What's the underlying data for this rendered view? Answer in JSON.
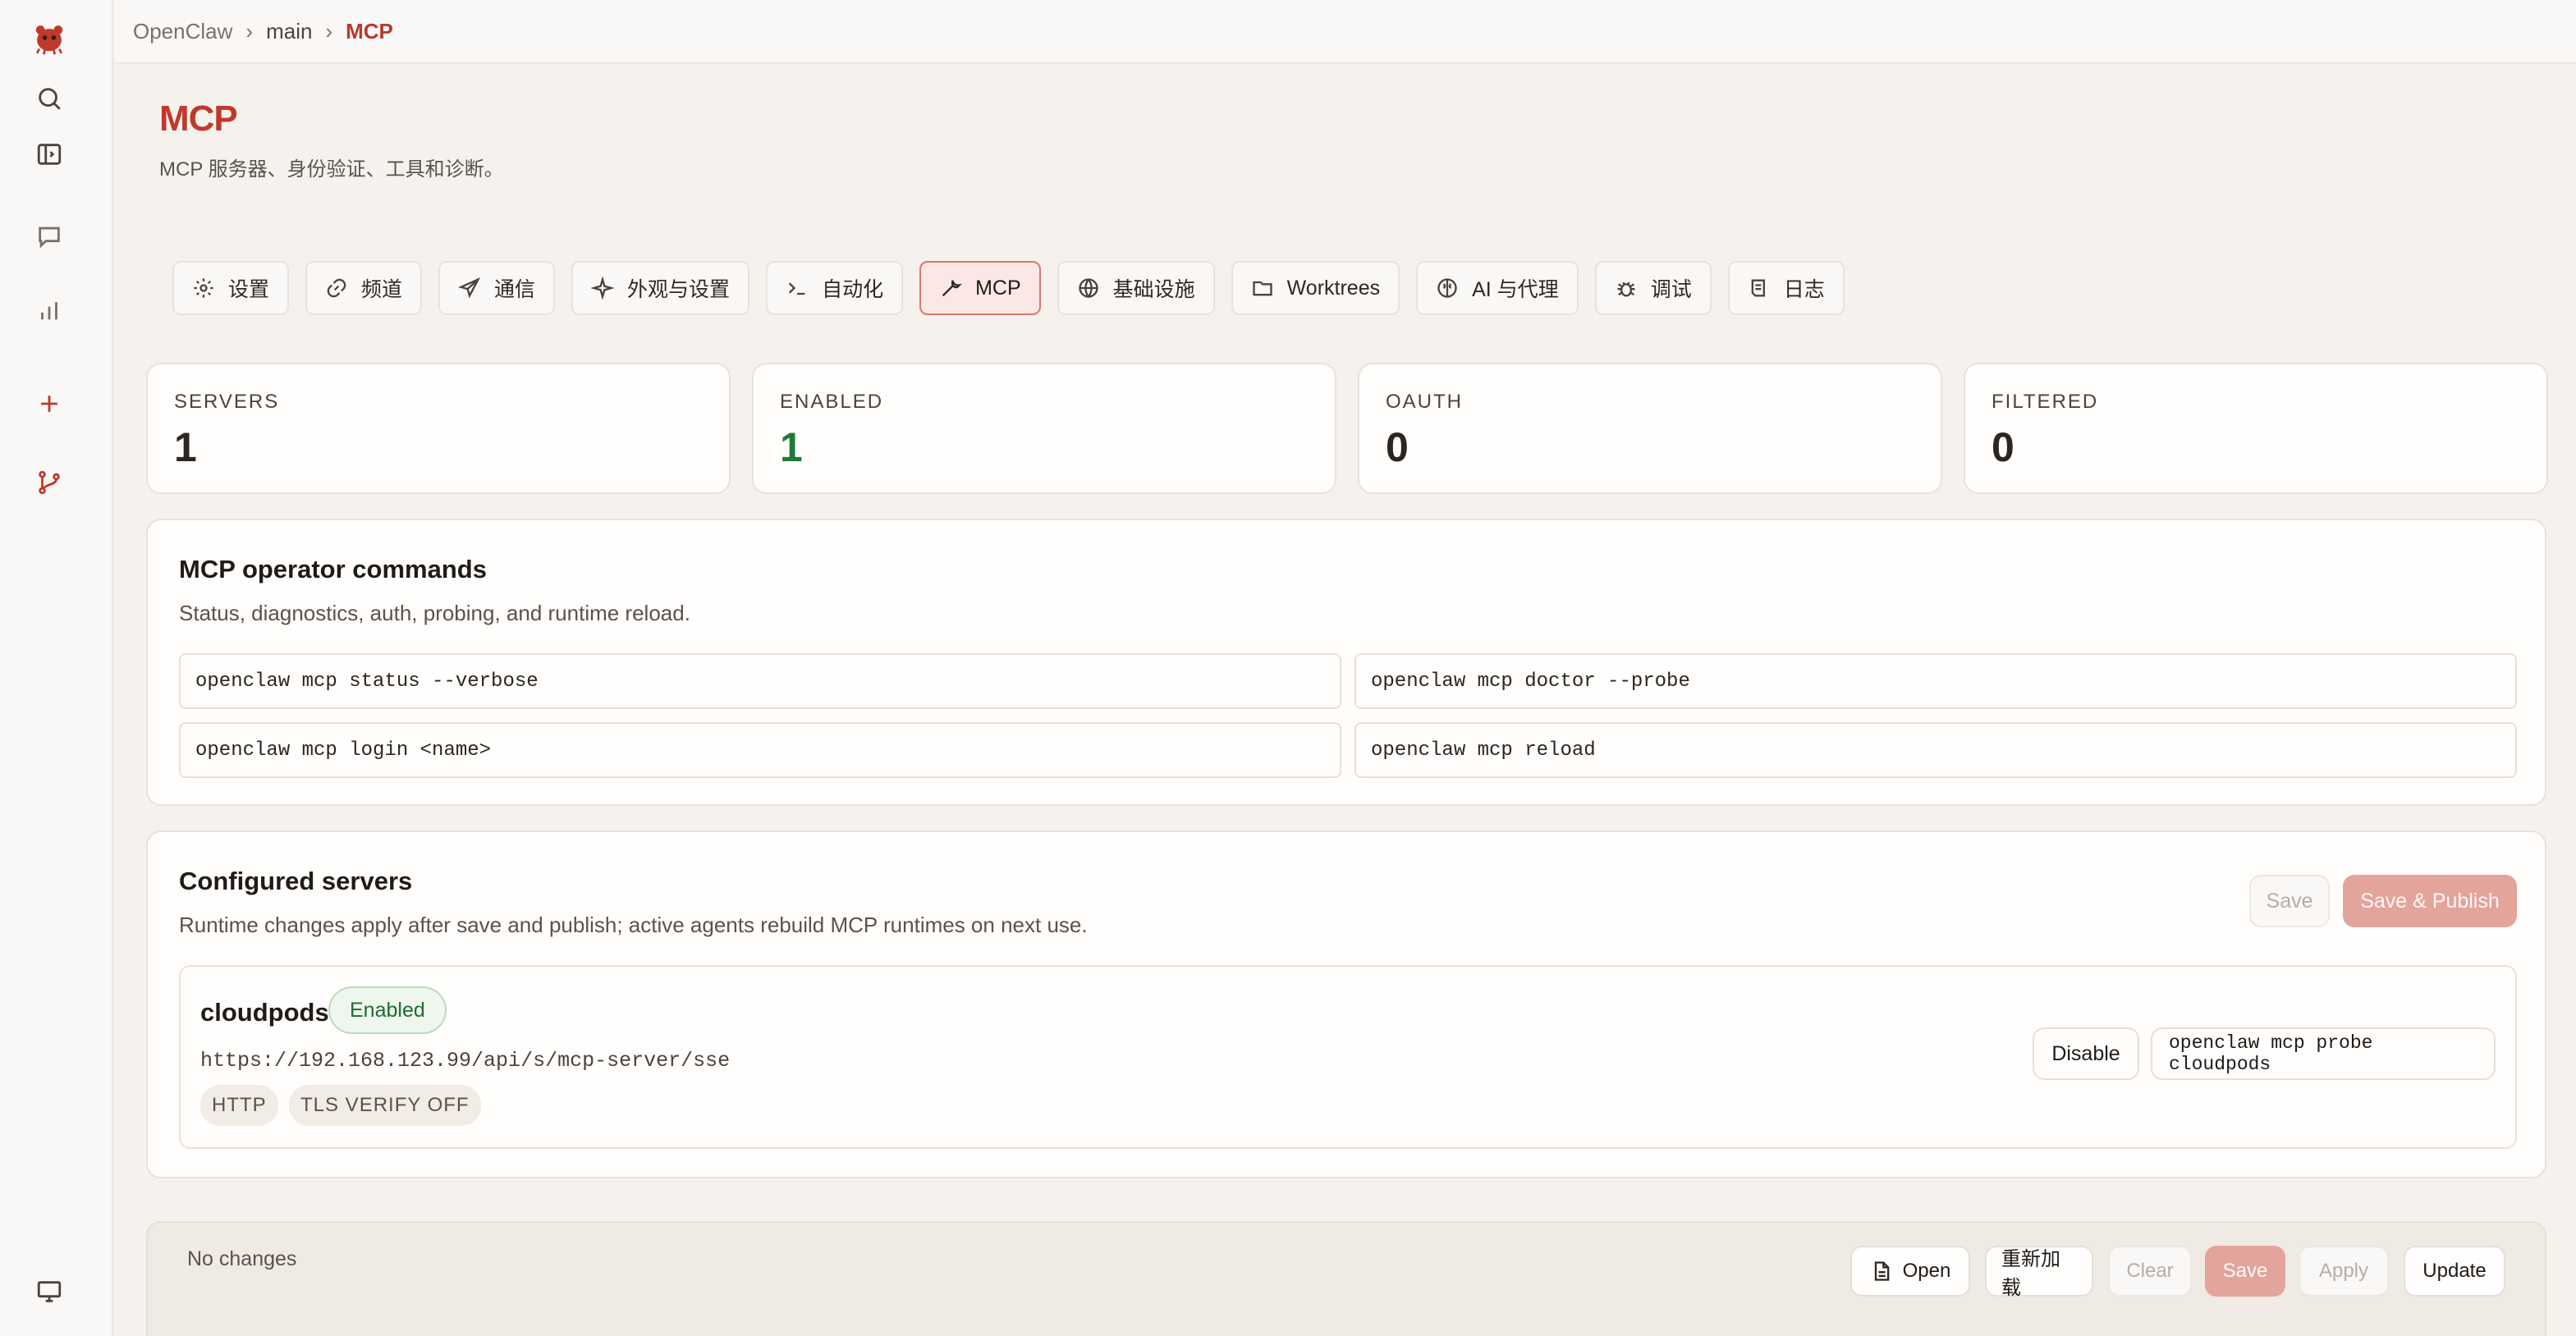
{
  "breadcrumb": [
    "OpenClaw",
    "main",
    "MCP"
  ],
  "page": {
    "title": "MCP",
    "subtitle": "MCP 服务器、身份验证、工具和诊断。"
  },
  "tabs": [
    {
      "label": "设置",
      "icon": "gear-icon"
    },
    {
      "label": "频道",
      "icon": "link-icon"
    },
    {
      "label": "通信",
      "icon": "send-icon"
    },
    {
      "label": "外观与设置",
      "icon": "sparkle-icon"
    },
    {
      "label": "自动化",
      "icon": "terminal-icon"
    },
    {
      "label": "MCP",
      "icon": "wrench-icon",
      "active": true
    },
    {
      "label": "基础设施",
      "icon": "globe-icon"
    },
    {
      "label": "Worktrees",
      "icon": "folder-icon"
    },
    {
      "label": "AI 与代理",
      "icon": "brain-icon"
    },
    {
      "label": "调试",
      "icon": "bug-icon"
    },
    {
      "label": "日志",
      "icon": "log-icon"
    }
  ],
  "stats": [
    {
      "label": "SERVERS",
      "value": "1"
    },
    {
      "label": "ENABLED",
      "value": "1"
    },
    {
      "label": "OAUTH",
      "value": "0"
    },
    {
      "label": "FILTERED",
      "value": "0"
    }
  ],
  "operator": {
    "title": "MCP operator commands",
    "desc": "Status, diagnostics, auth, probing, and runtime reload.",
    "commands": [
      "openclaw mcp status --verbose",
      "openclaw mcp doctor --probe",
      "openclaw mcp login <name>",
      "openclaw mcp reload"
    ]
  },
  "servers_panel": {
    "title": "Configured servers",
    "desc": "Runtime changes apply after save and publish; active agents rebuild MCP runtimes on next use.",
    "save_label": "Save",
    "save_publish_label": "Save & Publish",
    "server": {
      "name": "cloudpods",
      "status": "Enabled",
      "url": "https://192.168.123.99/api/s/mcp-server/sse",
      "tags": [
        "HTTP",
        "TLS VERIFY OFF"
      ],
      "disable_label": "Disable",
      "probe_command": "openclaw mcp probe cloudpods"
    }
  },
  "footer": {
    "status": "No changes",
    "open_label": "Open",
    "reload_label": "重新加载",
    "clear_label": "Clear",
    "save_label": "Save",
    "apply_label": "Apply",
    "update_label": "Update"
  },
  "colors": {
    "accent": "#c0392b",
    "enabled_green": "#1f7a3a",
    "background": "#f5f2ee"
  }
}
